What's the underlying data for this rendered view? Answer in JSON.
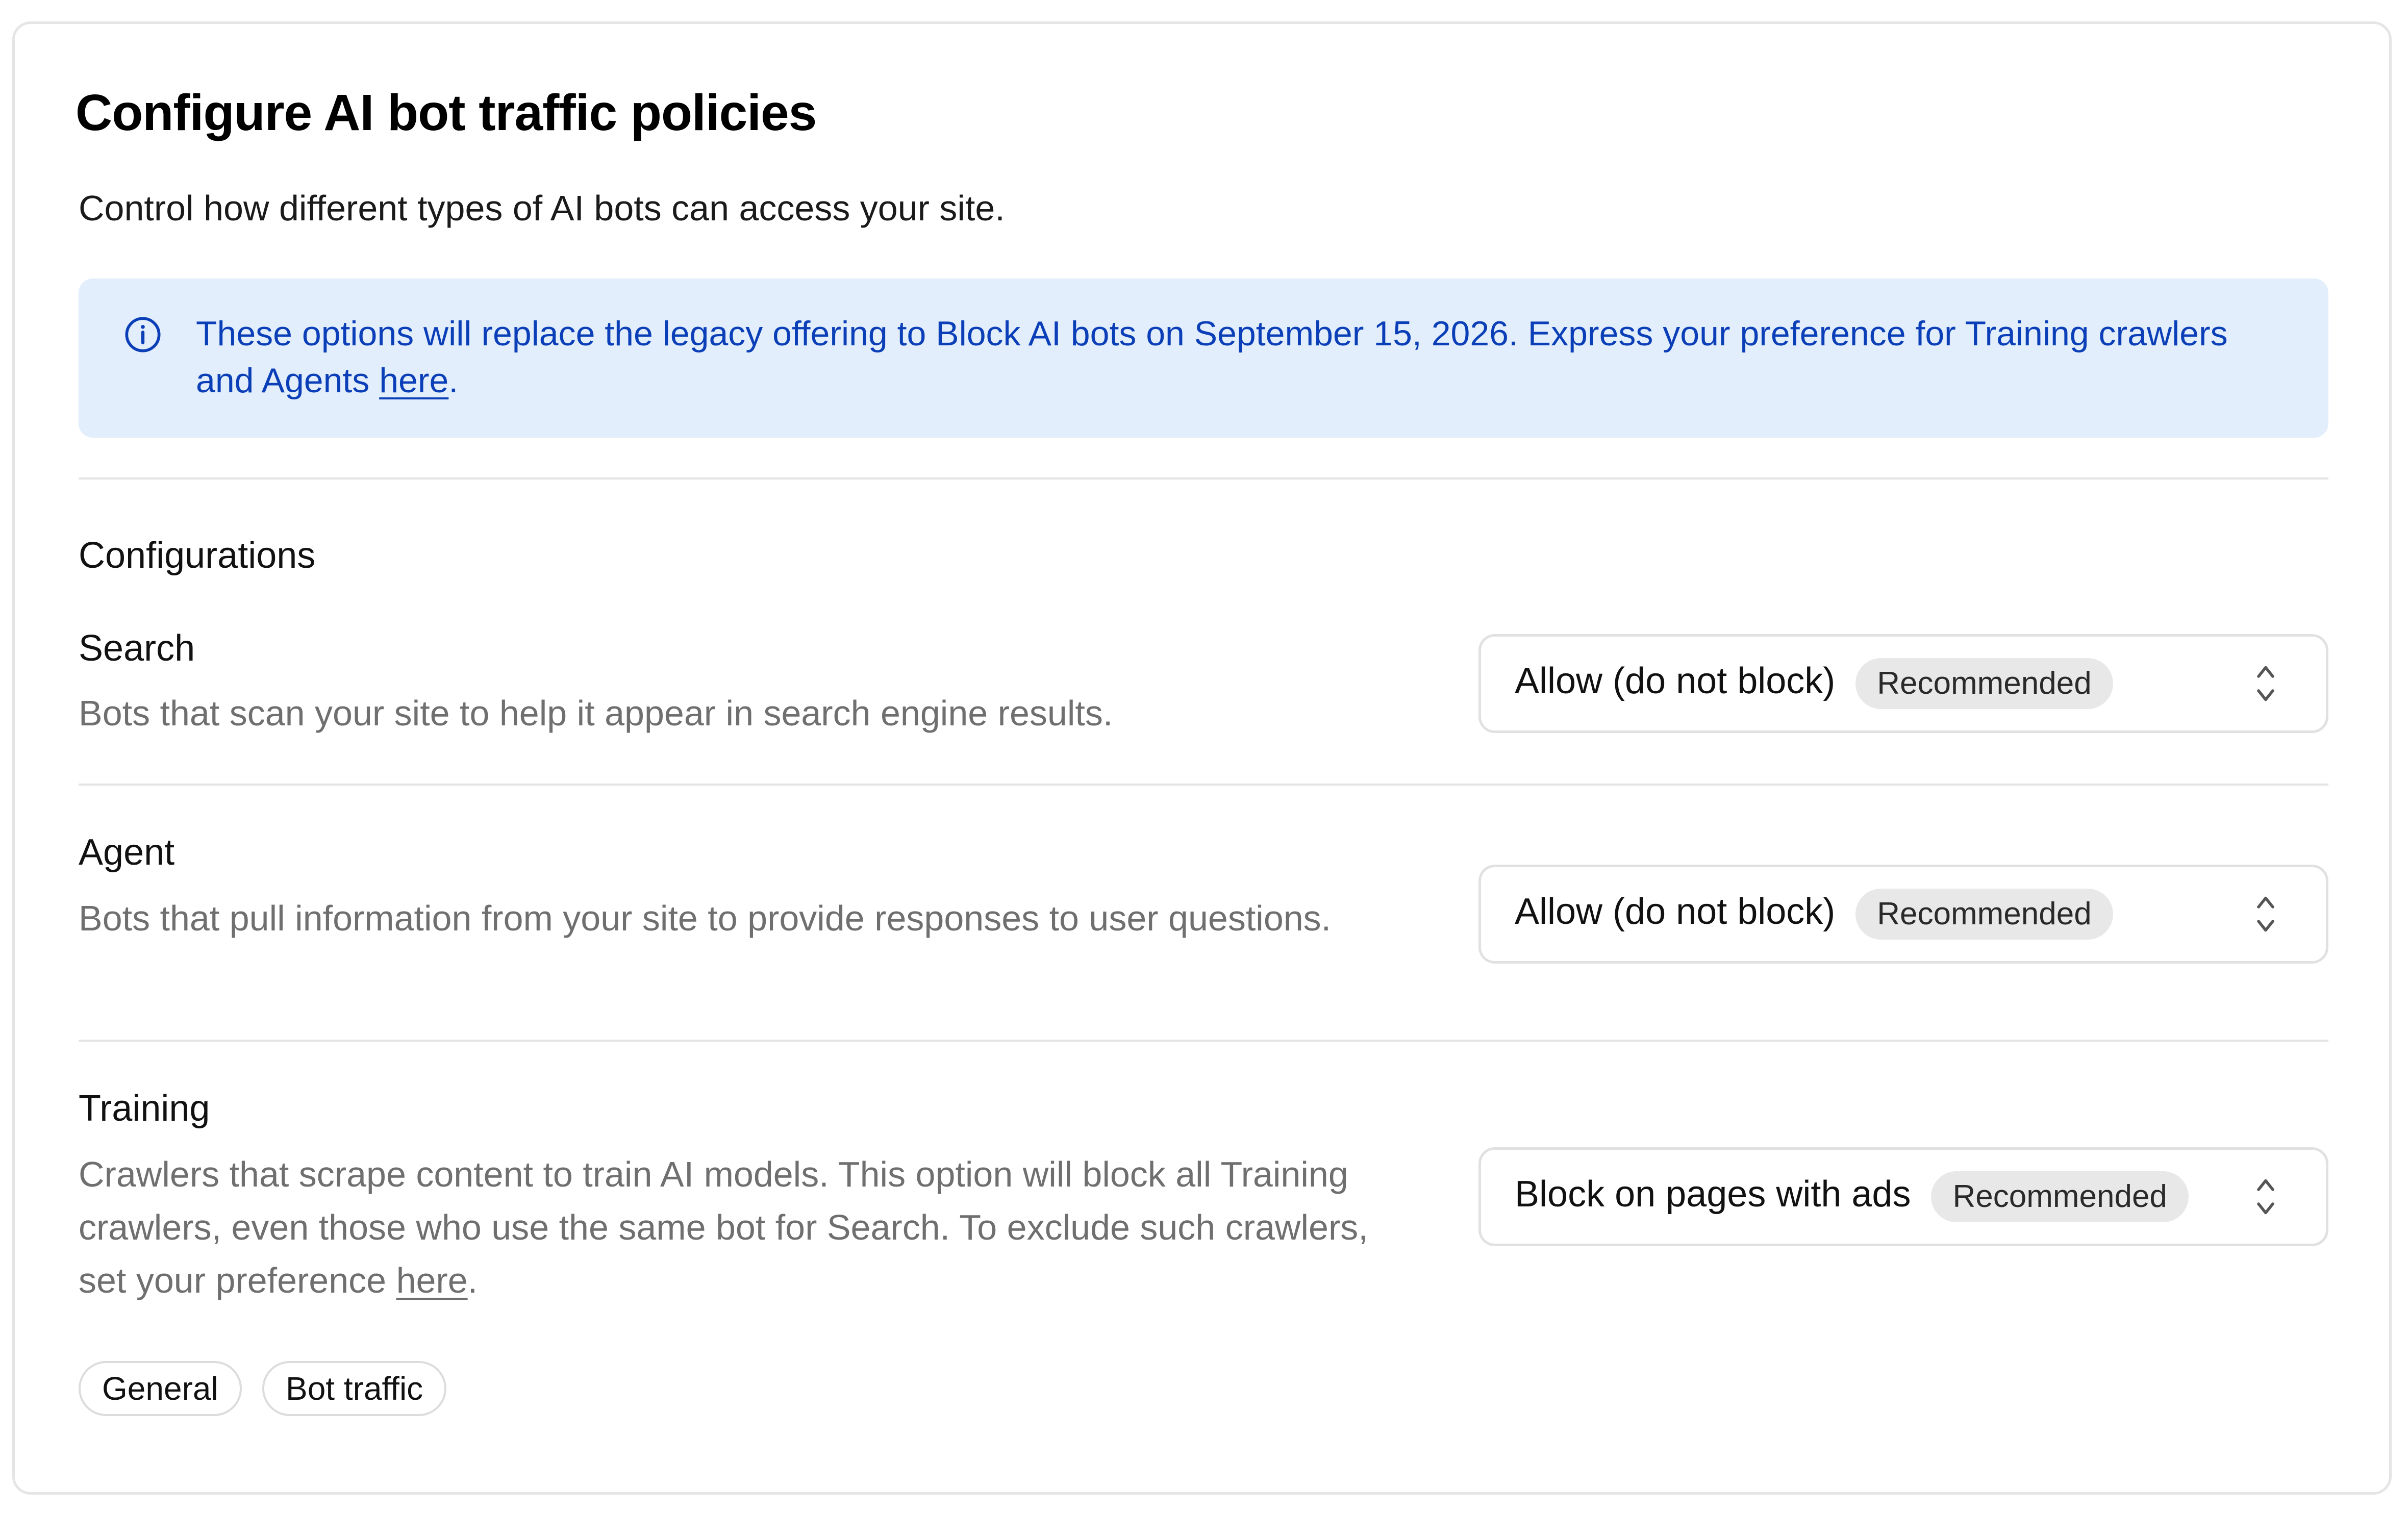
{
  "page": {
    "title": "Configure AI bot traffic policies",
    "subtitle": "Control how different types of AI bots can access your site."
  },
  "banner": {
    "icon": "info-icon",
    "text_before_link": "These options will replace the legacy offering to Block AI bots on September 15, 2026. Express your preference for Training crawlers and Agents ",
    "link_label": "here",
    "text_after_link": ".",
    "text_color": "#0b3fb8",
    "background_color": "#e3eefc"
  },
  "configurations": {
    "heading": "Configurations",
    "rows": [
      {
        "title": "Search",
        "description": "Bots that scan your site to help it appear in search engine results.",
        "selected_value": "Allow (do not block)",
        "badge": "Recommended"
      },
      {
        "title": "Agent",
        "description": "Bots that pull information from your site to provide responses to user questions.",
        "selected_value": "Allow (do not block)",
        "badge": "Recommended"
      },
      {
        "title": "Training",
        "description_before_link": "Crawlers that scrape content to train AI models. This option will block all Training crawlers, even those who use the same bot for Search. To exclude such crawlers, set your preference ",
        "link_label": "here",
        "description_after_link": ".",
        "selected_value": "Block on pages with ads",
        "badge": "Recommended"
      }
    ]
  },
  "tags": [
    "General",
    "Bot traffic"
  ],
  "icons": {
    "select_indicator": "chevron-up-down-icon"
  }
}
